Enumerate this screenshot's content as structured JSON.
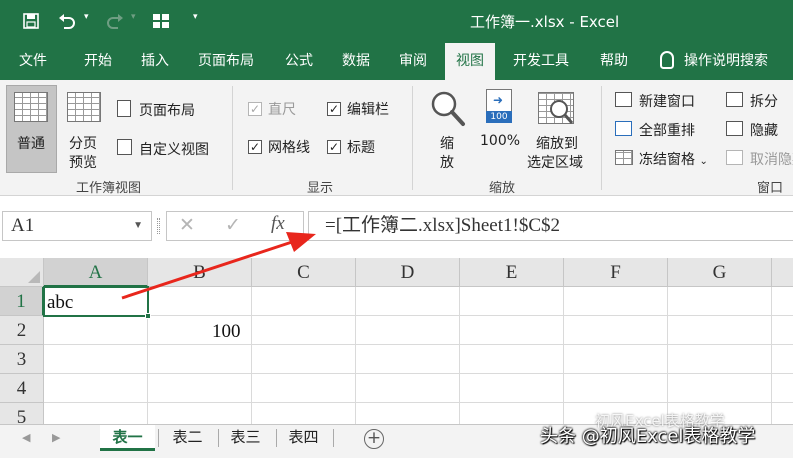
{
  "window": {
    "title": "工作簿一.xlsx  -  Excel",
    "colors": {
      "brand": "#217346",
      "ribbon": "#f3f3f3",
      "annotation": "#e8261c"
    }
  },
  "qat": {
    "save_icon": "save-icon",
    "undo_icon": "undo-icon",
    "redo_icon": "redo-icon",
    "grid_icon": "table-icon",
    "customize_icon": "chevron-down-icon"
  },
  "tabs": [
    {
      "label": "文件"
    },
    {
      "label": "开始"
    },
    {
      "label": "插入"
    },
    {
      "label": "页面布局"
    },
    {
      "label": "公式"
    },
    {
      "label": "数据"
    },
    {
      "label": "审阅"
    },
    {
      "label": "视图"
    },
    {
      "label": "开发工具"
    },
    {
      "label": "帮助"
    }
  ],
  "active_tab": "视图",
  "tell_me": "操作说明搜索",
  "ribbon": {
    "workbook_view": {
      "label": "工作簿视图",
      "normal": "普通",
      "page_break_l1": "分页",
      "page_break_l2": "预览",
      "page_layout": "页面布局",
      "custom_view": "自定义视图"
    },
    "show": {
      "label": "显示",
      "ruler": "直尺",
      "formula_bar": "编辑栏",
      "gridlines": "网格线",
      "headings": "标题"
    },
    "zoom": {
      "label": "缩放",
      "zoom_l1": "缩",
      "zoom_l2": "放",
      "hundred": "100%",
      "hundred_icon": "100",
      "to_selection_l1": "缩放到",
      "to_selection_l2": "选定区域"
    },
    "window": {
      "label": "窗口",
      "new_window": "新建窗口",
      "arrange_all": "全部重排",
      "freeze_panes": "冻结窗格",
      "split": "拆分",
      "hide": "隐藏",
      "unhide": "取消隐藏"
    }
  },
  "formula_bar": {
    "name_box": "A1",
    "cancel_icon": "close-icon",
    "enter_icon": "check-icon",
    "fx": "fx",
    "formula": "=[工作簿二.xlsx]Sheet1!$C$2"
  },
  "grid": {
    "columns": [
      "A",
      "B",
      "C",
      "D",
      "E",
      "F",
      "G"
    ],
    "rows": [
      "1",
      "2",
      "3",
      "4",
      "5"
    ],
    "cells": {
      "A1": "abc",
      "B2": "100"
    },
    "selected_cell": "A1"
  },
  "sheets": [
    {
      "label": "表一",
      "active": true
    },
    {
      "label": "表二"
    },
    {
      "label": "表三"
    },
    {
      "label": "表四"
    }
  ],
  "watermark": {
    "main": "头条 @初风Excel表格教学",
    "secondary": "初风Excel表格教学"
  }
}
